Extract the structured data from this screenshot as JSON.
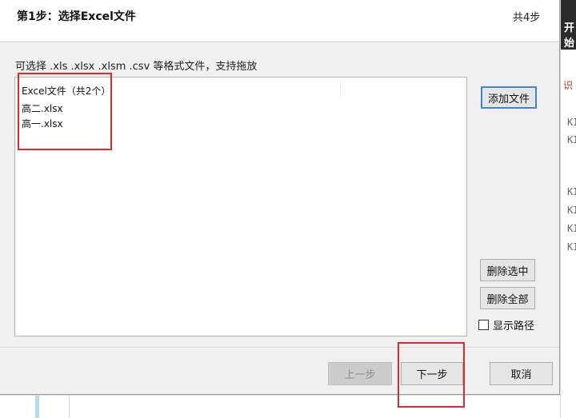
{
  "dialog": {
    "title": "第1步：选择Excel文件",
    "step_count": "共4步",
    "hint": "可选择 .xls  .xlsx  .xlsm .csv 等格式文件，支持拖放",
    "file_list": {
      "header": "Excel文件（共2个）",
      "files": [
        "高二.xlsx",
        "高一.xlsx"
      ]
    },
    "buttons": {
      "add_file": "添加文件",
      "delete_selected": "删除选中",
      "delete_all": "删除全部",
      "prev": "上一步",
      "next": "下一步",
      "cancel": "取消"
    },
    "show_path": {
      "label": "显示路径",
      "checked": false
    }
  },
  "background": {
    "top_strip_text": "开始",
    "red_text": "识",
    "rows": [
      "KI",
      "KI",
      "KI",
      "KI",
      "KI",
      "KI"
    ]
  },
  "colors": {
    "annotation": "#e02a2a",
    "focus_border": "#3b86d6"
  }
}
